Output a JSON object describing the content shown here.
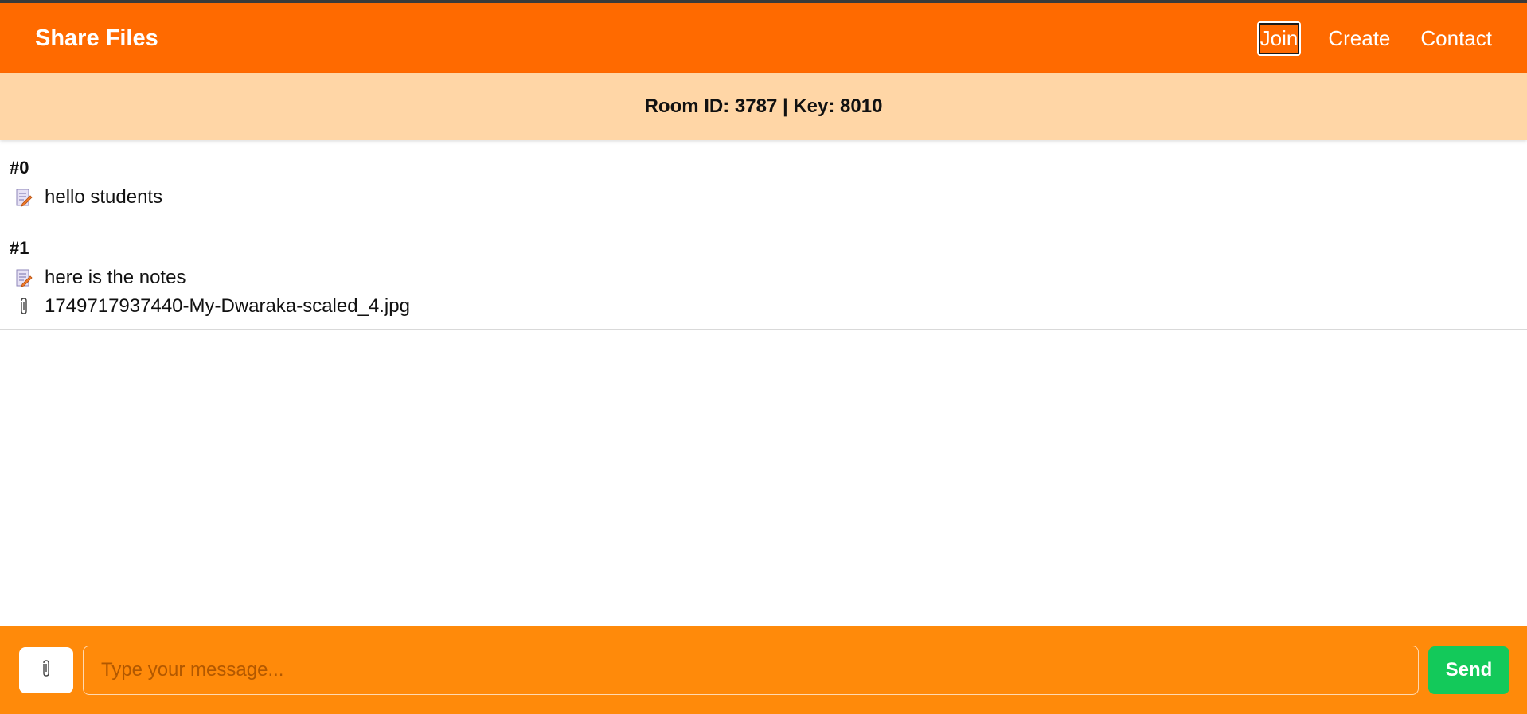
{
  "header": {
    "brand": "Share Files",
    "nav": [
      {
        "label": "Join",
        "active": true
      },
      {
        "label": "Create",
        "active": false
      },
      {
        "label": "Contact",
        "active": false
      }
    ]
  },
  "room": {
    "info": "Room ID: 3787 | Key: 8010"
  },
  "messages": [
    {
      "index": "#0",
      "lines": [
        {
          "icon": "memo-icon",
          "text": "hello students"
        }
      ]
    },
    {
      "index": "#1",
      "lines": [
        {
          "icon": "memo-icon",
          "text": "here is the notes"
        },
        {
          "icon": "paperclip-icon",
          "text": "1749717937440-My-Dwaraka-scaled_4.jpg"
        }
      ]
    }
  ],
  "composer": {
    "attach_icon": "paperclip-icon",
    "placeholder": "Type your message...",
    "value": "",
    "send_label": "Send"
  },
  "colors": {
    "header": "#ff6a00",
    "room_bar": "#ffd6a6",
    "composer": "#ff8a0a",
    "send": "#13c95a"
  }
}
